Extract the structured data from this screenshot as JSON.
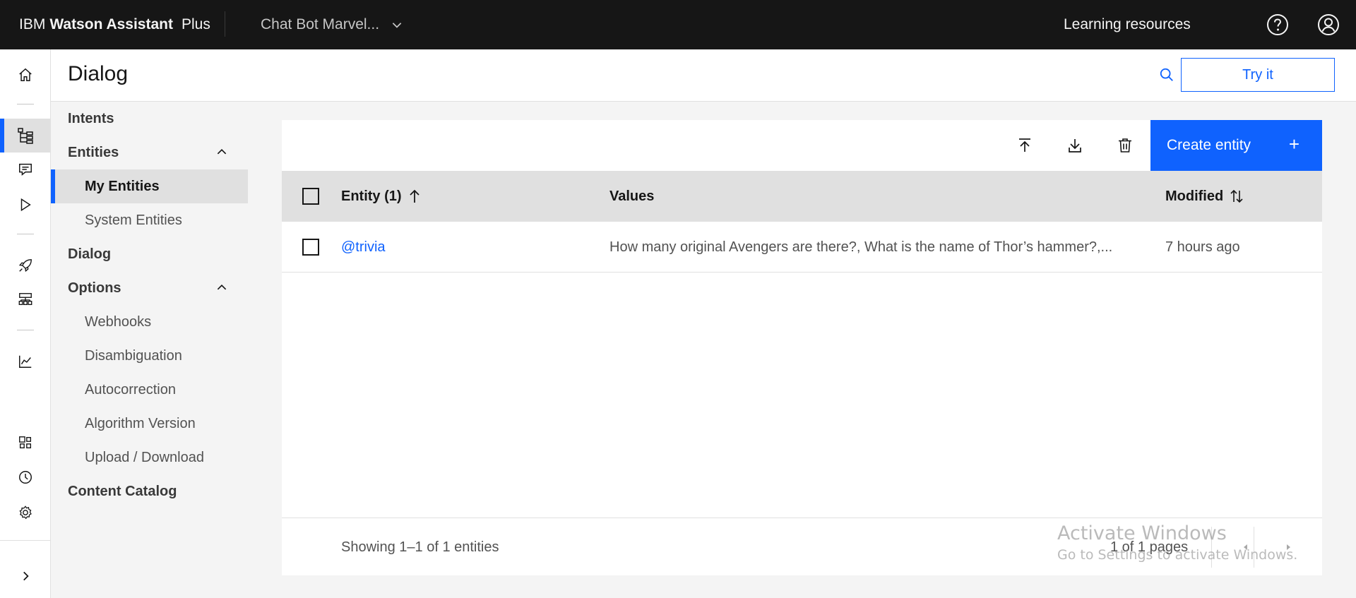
{
  "header": {
    "brand_ibm": "IBM",
    "brand_product": "Watson Assistant",
    "brand_plan": "Plus",
    "assistant_name": "Chat Bot Marvel...",
    "learning_resources": "Learning resources",
    "help_icon": "help-icon",
    "user_icon": "user-avatar-icon"
  },
  "rail": {
    "items": [
      "home-icon",
      "dialog-tree-icon",
      "chat-icon",
      "play-icon",
      "rocket-icon",
      "integrations-icon",
      "analytics-icon",
      "apps-icon",
      "history-icon",
      "settings-icon",
      "expand-icon"
    ]
  },
  "page": {
    "title": "Dialog",
    "try_it": "Try it"
  },
  "subnav": {
    "intents": "Intents",
    "entities": "Entities",
    "my_entities": "My Entities",
    "system_entities": "System Entities",
    "dialog": "Dialog",
    "options": "Options",
    "webhooks": "Webhooks",
    "disambiguation": "Disambiguation",
    "autocorrection": "Autocorrection",
    "algorithm_version": "Algorithm Version",
    "upload_download": "Upload / Download",
    "content_catalog": "Content Catalog"
  },
  "toolbar": {
    "create_entity": "Create entity",
    "plus": "+"
  },
  "table": {
    "columns": {
      "entity": "Entity (1)",
      "values": "Values",
      "modified": "Modified"
    },
    "rows": [
      {
        "entity": "@trivia",
        "values": "How many original Avengers are there?, What is the name of Thor’s hammer?,...",
        "modified": "7 hours ago"
      }
    ],
    "showing": "Showing 1–1 of 1 entities",
    "pages": "1 of 1 pages"
  },
  "watermark": {
    "line1": "Activate Windows",
    "line2": "Go to Settings to activate Windows."
  },
  "colors": {
    "accent": "#0f62fe",
    "header_bg": "#161616",
    "page_bg": "#f4f4f4"
  }
}
